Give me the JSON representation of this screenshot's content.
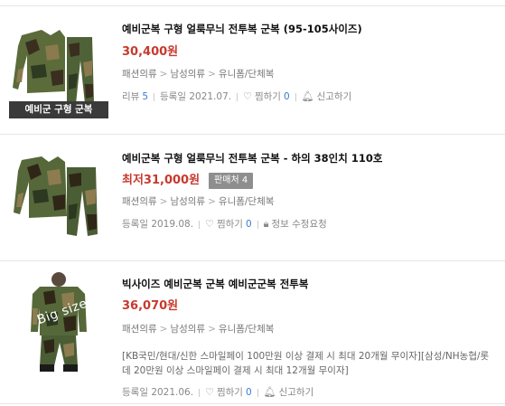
{
  "results": [
    {
      "title": "예비군복 구형 얼룩무늬 전투복 군복 (95-105사이즈)",
      "price": "30,400원",
      "thumbnail_caption": "예비군 구형 군복",
      "category": [
        "패션의류",
        "남성의류",
        "유니폼/단체복"
      ],
      "meta": {
        "review_label": "리뷰",
        "review_count": "5",
        "date": "등록일 2021.07.",
        "wish_label": "찜하기",
        "wish_count": "0",
        "report_label": "신고하기"
      }
    },
    {
      "title": "예비군복 구형 얼룩무늬 전투복 군복 - 하의 38인치 110호",
      "price": "최저31,000원",
      "seller_badge": "판매처 4",
      "category": [
        "패션의류",
        "남성의류",
        "유니폼/단체복"
      ],
      "meta": {
        "date": "등록일 2019.08.",
        "wish_label": "찜하기",
        "wish_count": "0",
        "info_label": "정보 수정요청"
      }
    },
    {
      "title": "빅사이즈 예비군복 군복 예비군군복 전투복",
      "price": "36,070원",
      "thumbnail_text": "Big size",
      "category": [
        "패션의류",
        "남성의류",
        "유니폼/단체복"
      ],
      "description": "[KB국민/현대/신한 스마일페이 100만원 이상 결제 시 최대 20개월 무이자][삼성/NH농협/롯데 20만원 이상 스마일페이 결제 시 최대 12개월 무이자]",
      "meta": {
        "date": "등록일 2021.06.",
        "wish_label": "찜하기",
        "wish_count": "0",
        "report_label": "신고하기"
      }
    }
  ],
  "icons": {
    "heart": "heart-icon",
    "bell": "bell-icon",
    "lock": "lock-icon"
  },
  "colors": {
    "price": "#c73a2e",
    "count": "#3a7bd5",
    "badge": "#8e8e8e"
  }
}
